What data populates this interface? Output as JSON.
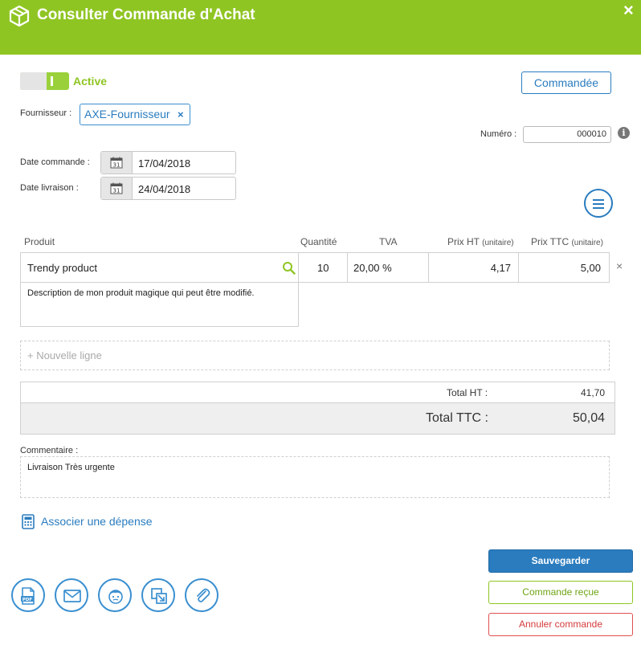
{
  "header": {
    "title": "Consulter Commande d'Achat",
    "close": "×"
  },
  "status": {
    "label": "Active",
    "active": true,
    "state_button": "Commandée"
  },
  "supplier": {
    "label": "Fournisseur :",
    "value": "AXE-Fournisseur",
    "remove": "×"
  },
  "numero": {
    "label": "Numéro :",
    "value": "000010",
    "info": "i"
  },
  "dates": {
    "order_label": "Date commande :",
    "order_value": "17/04/2018",
    "delivery_label": "Date livraison :",
    "delivery_value": "24/04/2018",
    "calendar_day": "31"
  },
  "table": {
    "headers": {
      "product": "Produit",
      "quantity": "Quantité",
      "tva": "TVA",
      "price_ht": "Prix HT",
      "price_ht_note": "(unitaire)",
      "price_ttc": "Prix TTC",
      "price_ttc_note": "(unitaire)"
    },
    "rows": [
      {
        "product": "Trendy product",
        "quantity": "10",
        "tva": "20,00 %",
        "price_ht": "4,17",
        "price_ttc": "5,00",
        "description": "Description de mon produit magique qui peut être modifié.",
        "remove": "×"
      }
    ],
    "new_line": "+ Nouvelle ligne"
  },
  "totals": {
    "ht_label": "Total HT :",
    "ht_value": "41,70",
    "ttc_label": "Total TTC :",
    "ttc_value": "50,04"
  },
  "comment": {
    "label": "Commentaire :",
    "value": "Livraison Très urgente"
  },
  "associate": "Associer une dépense",
  "actions": {
    "save": "Sauvegarder",
    "received": "Commande reçue",
    "cancel": "Annuler commande"
  },
  "tool_icons": {
    "pdf": "PDF"
  },
  "colors": {
    "brand_green": "#8fc523",
    "primary_blue": "#2a7cbf",
    "danger_red": "#d43b3b"
  }
}
